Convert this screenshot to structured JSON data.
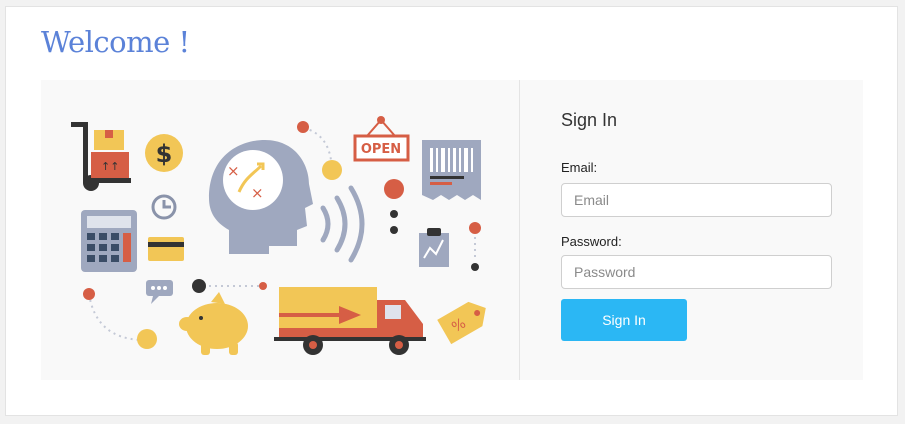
{
  "page": {
    "title": "Welcome !"
  },
  "illustration": {
    "open_sign_text": "OPEN",
    "dollar_symbol": "$",
    "tag_text": "%",
    "colors": {
      "yellow": "#f2c656",
      "red": "#d65e45",
      "slate": "#9fa8bf",
      "dark": "#333333"
    }
  },
  "signin": {
    "title": "Sign In",
    "email_label": "Email:",
    "email_placeholder": "Email",
    "email_value": "",
    "password_label": "Password:",
    "password_placeholder": "Password",
    "password_value": "",
    "submit_label": "Sign In",
    "accent_color": "#2bb7f4"
  }
}
